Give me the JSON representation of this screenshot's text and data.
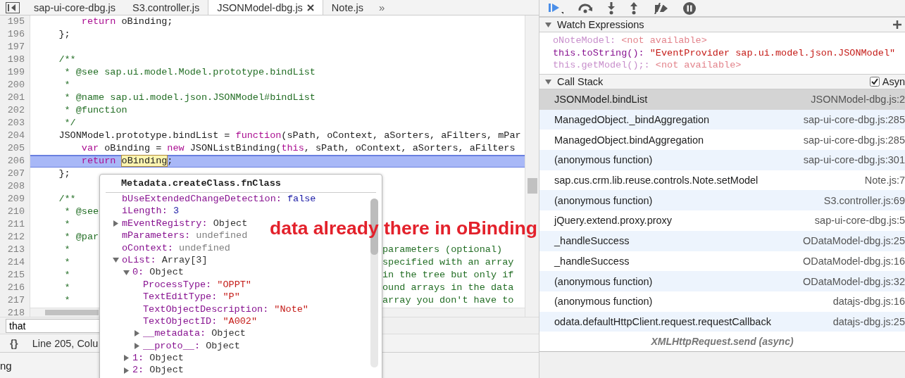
{
  "editor_tabs": [
    {
      "label": "sap-ui-core-dbg.js",
      "selected": false,
      "closable": false
    },
    {
      "label": "S3.controller.js",
      "selected": false,
      "closable": false
    },
    {
      "label": "JSONModel-dbg.js",
      "selected": true,
      "closable": true
    },
    {
      "label": "Note.js",
      "selected": false,
      "closable": false
    }
  ],
  "tab_overflow": "»",
  "code_lines": [
    {
      "number": "195",
      "highlighted": false,
      "tokens": [
        {
          "kind": "keyword",
          "text": "        return"
        },
        {
          "kind": "plain",
          "text": " oBinding;"
        }
      ]
    },
    {
      "number": "196",
      "highlighted": false,
      "tokens": [
        {
          "kind": "plain",
          "text": "    };"
        }
      ]
    },
    {
      "number": "197",
      "highlighted": false
    },
    {
      "number": "198",
      "highlighted": false,
      "tokens": [
        {
          "kind": "comment",
          "text": "    /**"
        }
      ]
    },
    {
      "number": "199",
      "highlighted": false,
      "tokens": [
        {
          "kind": "comment",
          "text": "     * @see sap.ui.model.Model.prototype.bindList"
        }
      ]
    },
    {
      "number": "200",
      "highlighted": false,
      "tokens": [
        {
          "kind": "comment",
          "text": "     *"
        }
      ]
    },
    {
      "number": "201",
      "highlighted": false,
      "tokens": [
        {
          "kind": "comment",
          "text": "     * @name sap.ui.model.json.JSONModel#bindList"
        }
      ]
    },
    {
      "number": "202",
      "highlighted": false,
      "tokens": [
        {
          "kind": "comment",
          "text": "     * @function"
        }
      ]
    },
    {
      "number": "203",
      "highlighted": false,
      "tokens": [
        {
          "kind": "comment",
          "text": "     */"
        }
      ]
    },
    {
      "number": "204",
      "highlighted": false,
      "tokens": [
        {
          "kind": "plain",
          "text": "    JSONModel.prototype.bindList = "
        },
        {
          "kind": "keyword",
          "text": "function"
        },
        {
          "kind": "plain",
          "text": "(sPath, oContext, aSorters, aFilters, mPar"
        }
      ]
    },
    {
      "number": "205",
      "highlighted": false,
      "tokens": [
        {
          "kind": "keyword",
          "text": "        var"
        },
        {
          "kind": "plain",
          "text": " oBinding = "
        },
        {
          "kind": "keyword",
          "text": "new"
        },
        {
          "kind": "plain",
          "text": " JSONListBinding("
        },
        {
          "kind": "keyword",
          "text": "this"
        },
        {
          "kind": "plain",
          "text": ", sPath, oContext, aSorters, aFilters"
        }
      ]
    },
    {
      "number": "206",
      "highlighted": true,
      "tokens": [
        {
          "kind": "keyword",
          "text": "        return "
        },
        {
          "kind": "match",
          "text": "oBinding"
        },
        {
          "kind": "plain",
          "text": ";"
        }
      ]
    },
    {
      "number": "207",
      "highlighted": false,
      "tokens": [
        {
          "kind": "plain",
          "text": "    };"
        }
      ]
    },
    {
      "number": "208",
      "highlighted": false
    },
    {
      "number": "209",
      "highlighted": false,
      "tokens": [
        {
          "kind": "comment",
          "text": "    /**"
        }
      ]
    },
    {
      "number": "210",
      "highlighted": false,
      "tokens": [
        {
          "kind": "comment",
          "text": "     * @see"
        }
      ]
    },
    {
      "number": "211",
      "highlighted": false,
      "tokens": [
        {
          "kind": "comment",
          "text": "     *"
        }
      ]
    },
    {
      "number": "212",
      "highlighted": false,
      "tokens": [
        {
          "kind": "comment",
          "text": "     * @par"
        }
      ]
    },
    {
      "number": "213",
      "highlighted": false,
      "tokens": [
        {
          "kind": "comment",
          "text": "     *"
        }
      ],
      "right_text": "parameters (optional)"
    },
    {
      "number": "214",
      "highlighted": false,
      "tokens": [
        {
          "kind": "comment",
          "text": "     *"
        }
      ],
      "right_text": "specified with an array"
    },
    {
      "number": "215",
      "highlighted": false,
      "tokens": [
        {
          "kind": "comment",
          "text": "     *"
        }
      ],
      "right_text": "in the tree but only if"
    },
    {
      "number": "216",
      "highlighted": false,
      "tokens": [
        {
          "kind": "comment",
          "text": "     *"
        }
      ],
      "right_text": "ound arrays in the data"
    },
    {
      "number": "217",
      "highlighted": false,
      "tokens": [
        {
          "kind": "comment",
          "text": "     *"
        }
      ],
      "right_text": "array you don't have to"
    },
    {
      "number": "218",
      "highlighted": false
    }
  ],
  "search": {
    "value": "that"
  },
  "status_bar": {
    "pretty_print": "{}",
    "position": "Line 205, Colu"
  },
  "bottom_bar": {
    "text": "ng"
  },
  "popover": {
    "title": "Metadata.createClass.fnClass",
    "properties": [
      {
        "name": "bUseExtendedChangeDetection:",
        "value": "false",
        "kind": "literal"
      },
      {
        "name": "iLength:",
        "value": "3",
        "kind": "literal"
      },
      {
        "name": "mEventRegistry:",
        "value": "Object",
        "kind": "object",
        "expanded": false
      },
      {
        "name": "mParameters:",
        "value": "undefined",
        "kind": "undefined"
      },
      {
        "name": "oContext:",
        "value": "undefined",
        "kind": "undefined"
      },
      {
        "name": "oList:",
        "value": "Array[3]",
        "kind": "object",
        "expanded": true,
        "children": [
          {
            "name": "0:",
            "value": "Object",
            "kind": "object",
            "expanded": true,
            "children": [
              {
                "name": "ProcessType:",
                "value": "\"OPPT\"",
                "kind": "string"
              },
              {
                "name": "TextEditType:",
                "value": "\"P\"",
                "kind": "string"
              },
              {
                "name": "TextObjectDescription:",
                "value": "\"Note\"",
                "kind": "string"
              },
              {
                "name": "TextObjectID:",
                "value": "\"A002\"",
                "kind": "string"
              },
              {
                "name": "__metadata:",
                "value": "Object",
                "kind": "object",
                "expanded": false
              },
              {
                "name": "__proto__:",
                "value": "Object",
                "kind": "object",
                "expanded": false
              }
            ]
          },
          {
            "name": "1:",
            "value": "Object",
            "kind": "object",
            "expanded": false
          },
          {
            "name": "2:",
            "value": "Object",
            "kind": "object",
            "expanded": false
          }
        ]
      }
    ]
  },
  "annotation": "data already there in oBinding",
  "watch_expressions": {
    "title": "Watch Expressions",
    "expanded": true,
    "items": [
      {
        "name": "oNoteModel:",
        "value": "<not available>",
        "available": false
      },
      {
        "name": "this.toString():",
        "value": "\"EventProvider sap.ui.model.json.JSONModel\"",
        "available": true
      },
      {
        "name": "this.getModel();:",
        "value": "<not available>",
        "available": false
      }
    ]
  },
  "call_stack": {
    "title": "Call Stack",
    "expanded": true,
    "async_checkbox": {
      "label": "Asyn",
      "checked": true
    },
    "frames": [
      {
        "function": "JSONModel.bindList",
        "location": "JSONModel-dbg.js:2",
        "selected": true
      },
      {
        "function": "ManagedObject._bindAggregation",
        "location": "sap-ui-core-dbg.js:285",
        "selected": false
      },
      {
        "function": "ManagedObject.bindAggregation",
        "location": "sap-ui-core-dbg.js:285",
        "selected": false
      },
      {
        "function": "(anonymous function)",
        "location": "sap-ui-core-dbg.js:301",
        "selected": false
      },
      {
        "function": "sap.cus.crm.lib.reuse.controls.Note.setModel",
        "location": "Note.js:7",
        "selected": false
      },
      {
        "function": "(anonymous function)",
        "location": "S3.controller.js:69",
        "selected": false
      },
      {
        "function": "jQuery.extend.proxy.proxy",
        "location": "sap-ui-core-dbg.js:5",
        "selected": false
      },
      {
        "function": "_handleSuccess",
        "location": "ODataModel-dbg.js:25",
        "selected": false
      },
      {
        "function": "_handleSuccess",
        "location": "ODataModel-dbg.js:16",
        "selected": false
      },
      {
        "function": "(anonymous function)",
        "location": "ODataModel-dbg.js:32",
        "selected": false
      },
      {
        "function": "(anonymous function)",
        "location": "datajs-dbg.js:16",
        "selected": false
      },
      {
        "function": "odata.defaultHttpClient.request.requestCallback",
        "location": "datajs-dbg.js:25",
        "selected": false
      }
    ],
    "async_marker": "XMLHttpRequest.send (async)"
  }
}
